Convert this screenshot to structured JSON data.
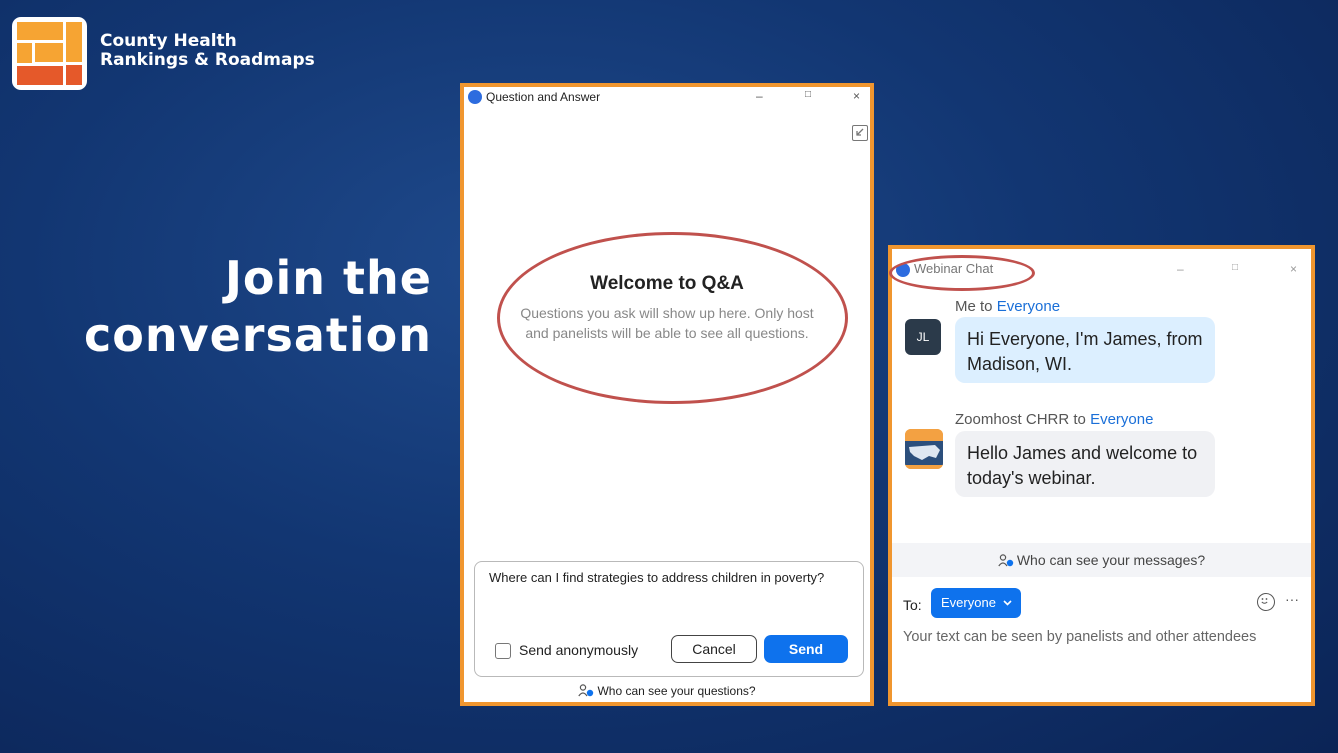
{
  "brand": {
    "line1": "County Health",
    "line2": "Rankings & Roadmaps"
  },
  "headline": {
    "line1": "Join the",
    "line2": "conversation"
  },
  "qa_window": {
    "title": "Question and Answer",
    "controls": {
      "minimize": "–",
      "maximize": "□",
      "close": "×"
    },
    "welcome_title": "Welcome to Q&A",
    "welcome_text": "Questions you ask will show up here. Only host and panelists will be able to see all questions.",
    "question_text": "Where can I find strategies to address children in poverty?",
    "send_anonymously": "Send anonymously",
    "cancel": "Cancel",
    "send": "Send",
    "who_can_see": "Who can see your questions?"
  },
  "chat_window": {
    "title": "Webinar Chat",
    "controls": {
      "minimize": "–",
      "maximize": "□",
      "close": "×"
    },
    "messages": [
      {
        "from": "Me",
        "connector": " to ",
        "to": "Everyone",
        "avatar": "JL",
        "text": "Hi Everyone, I'm James, from Madison, WI."
      },
      {
        "from": "Zoomhost CHRR",
        "connector": " to ",
        "to": "Everyone",
        "text": "Hello James and welcome to today's webinar."
      }
    ],
    "who_can_see": "Who can see your messages?",
    "to_label": "To:",
    "recipient": "Everyone",
    "placeholder": "Your text can be seen by panelists and other attendees",
    "more": "···"
  },
  "colors": {
    "accent_orange": "#f0962f",
    "zoom_blue": "#0e72ed",
    "highlight_red": "#c0514d",
    "background": "#123672"
  }
}
